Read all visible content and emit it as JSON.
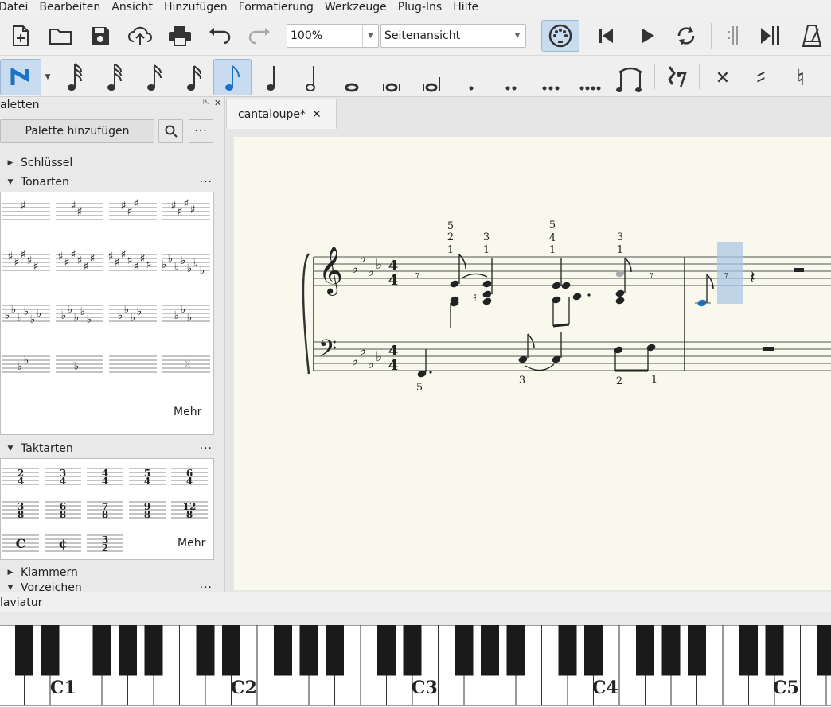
{
  "menu": [
    "Datei",
    "Bearbeiten",
    "Ansicht",
    "Hinzufügen",
    "Formatierung",
    "Werkzeuge",
    "Plug-Ins",
    "Hilfe"
  ],
  "toolbar": {
    "zoom_value": "100%",
    "view_mode": "Seitenansicht",
    "icons": [
      "new-file-icon",
      "open-folder-icon",
      "save-icon",
      "upload-cloud-icon",
      "print-icon",
      "undo-icon",
      "redo-icon",
      "midi-input-icon",
      "rewind-icon",
      "play-icon",
      "loop-icon",
      "loop-in-icon",
      "loop-out-icon",
      "metronome-icon"
    ]
  },
  "note_toolbar": {
    "icons": [
      "note-input-icon",
      "1024th-note-icon",
      "512th-note-icon",
      "256th-note-icon",
      "128th-note-icon",
      "64th-note-icon",
      "32nd-note-icon",
      "16th-note-icon",
      "eighth-note-icon",
      "quarter-note-icon",
      "half-note-icon",
      "whole-note-icon",
      "breve-icon",
      "longa-icon",
      "dot-icon",
      "double-dot-icon",
      "triple-dot-icon",
      "quadruple-dot-icon",
      "tie-icon",
      "slur-icon",
      "rest-toggle-icon",
      "double-sharp-icon",
      "sharp-icon",
      "natural-icon"
    ],
    "selected": "eighth-note-icon"
  },
  "palettes": {
    "title": "aletten",
    "add_button": "Palette hinzufügen",
    "sections": [
      {
        "label": "Schlüssel",
        "expanded": false
      },
      {
        "label": "Tonarten",
        "expanded": true
      },
      {
        "label": "Taktarten",
        "expanded": true
      },
      {
        "label": "Klammern",
        "expanded": false
      },
      {
        "label": "Vorzeichen",
        "expanded": true
      }
    ],
    "more_label": "Mehr",
    "time_signatures": [
      [
        "2",
        "4"
      ],
      [
        "3",
        "4"
      ],
      [
        "4",
        "4"
      ],
      [
        "5",
        "4"
      ],
      [
        "6",
        "4"
      ],
      [
        "3",
        "8"
      ],
      [
        "6",
        "8"
      ],
      [
        "7",
        "8"
      ],
      [
        "9",
        "8"
      ],
      [
        "12",
        "8"
      ]
    ],
    "time_symbols": [
      "C",
      "¢"
    ],
    "last_time": [
      "3",
      "2"
    ]
  },
  "tab": {
    "label": "cantaloupe*",
    "close": "✕"
  },
  "score": {
    "fingerings": [
      "5",
      "2",
      "1",
      "3",
      "1",
      "5",
      "4",
      "1",
      "3",
      "1",
      "5",
      "3",
      "2",
      "1"
    ]
  },
  "keyboard": {
    "title": "laviatur",
    "octave_labels": [
      "C1",
      "C2",
      "C3",
      "C4",
      "C5"
    ]
  },
  "colors": {
    "accent": "#1a73c4",
    "selection": "#a7c6e6",
    "paper": "#f8f8ec"
  }
}
